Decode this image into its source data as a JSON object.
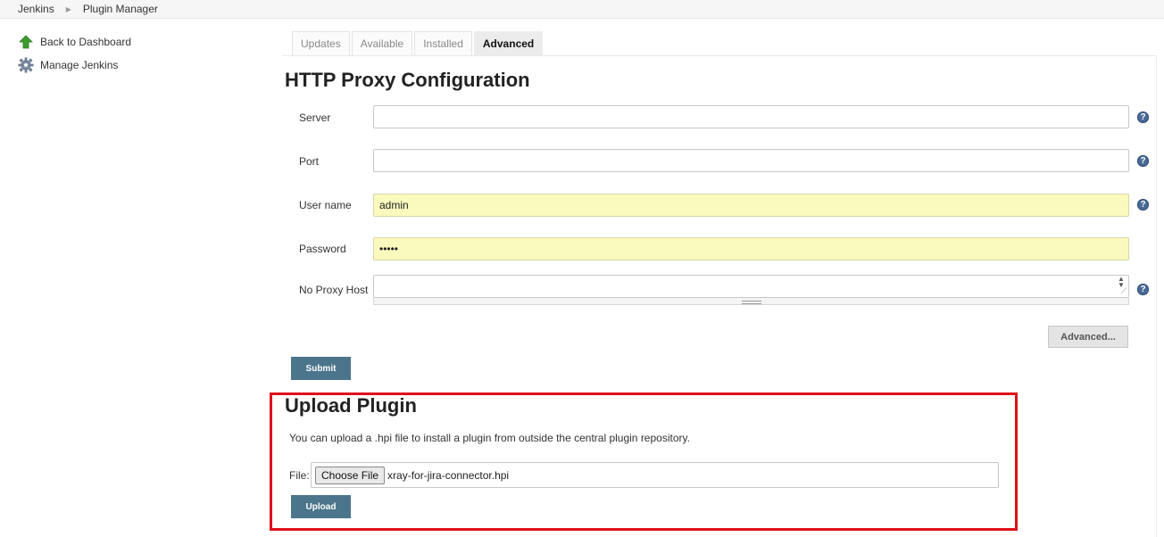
{
  "breadcrumb": {
    "root": "Jenkins",
    "current": "Plugin Manager"
  },
  "sidebar": {
    "back": "Back to Dashboard",
    "manage": "Manage Jenkins"
  },
  "tabs": [
    "Updates",
    "Available",
    "Installed",
    "Advanced"
  ],
  "active_tab": "Advanced",
  "proxy": {
    "title": "HTTP Proxy Configuration",
    "server_label": "Server",
    "server_value": "",
    "port_label": "Port",
    "port_value": "",
    "username_label": "User name",
    "username_value": "admin",
    "password_label": "Password",
    "password_value": "•••••",
    "noproxy_label": "No Proxy Host",
    "noproxy_value": "",
    "advanced_button": "Advanced...",
    "submit_button": "Submit"
  },
  "upload": {
    "title": "Upload Plugin",
    "description": "You can upload a .hpi file to install a plugin from outside the central plugin repository.",
    "file_label": "File:",
    "choose_button": "Choose File",
    "file_name": "xray-for-jira-connector.hpi",
    "upload_button": "Upload"
  },
  "help_glyph": "?",
  "colors": {
    "primary_button": "#4b758b",
    "autofill_bg": "#fafabe",
    "highlight_border": "#e0101b",
    "help_icon": "#4a6a95"
  }
}
